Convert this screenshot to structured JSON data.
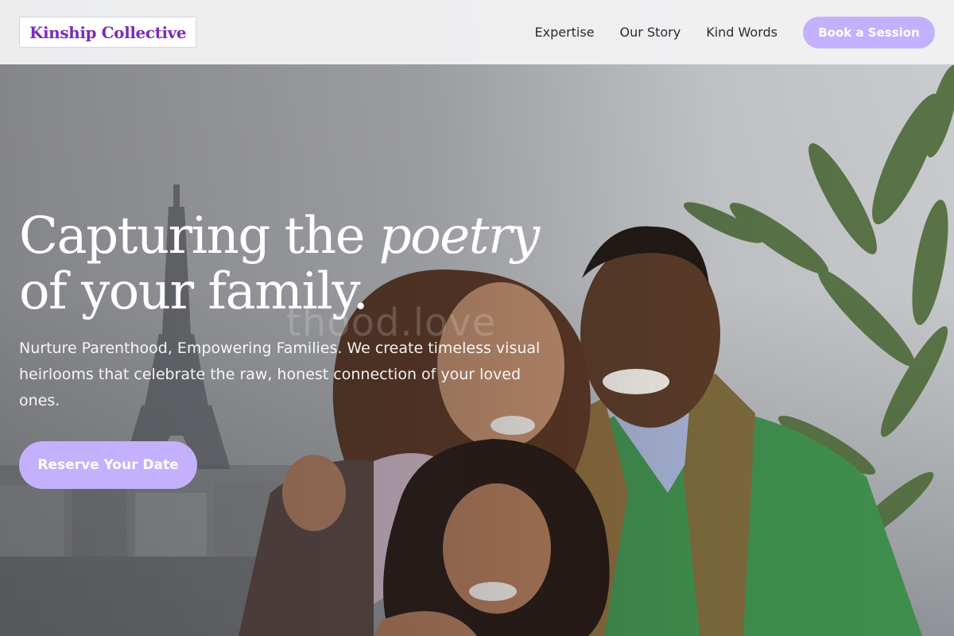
{
  "header": {
    "logo": "Kinship Collective",
    "nav": [
      {
        "label": "Expertise"
      },
      {
        "label": "Our Story"
      },
      {
        "label": "Kind Words"
      }
    ],
    "cta_label": "Book a Session"
  },
  "hero": {
    "headline_plain": "Capturing the ",
    "headline_italic": "poetry",
    "headline_line2": "of your family.",
    "subtext": "Nurture Parenthood, Empowering Families. We create timeless visual heirlooms that celebrate the raw, honest connection of your loved ones.",
    "cta_label": "Reserve Your Date",
    "photo_watermark": "thood.love"
  },
  "colors": {
    "accent": "#c3b1fd",
    "logo_text": "#7b2cb4",
    "nav_text": "#2b2b30",
    "header_bg": "#f1f1f2"
  }
}
